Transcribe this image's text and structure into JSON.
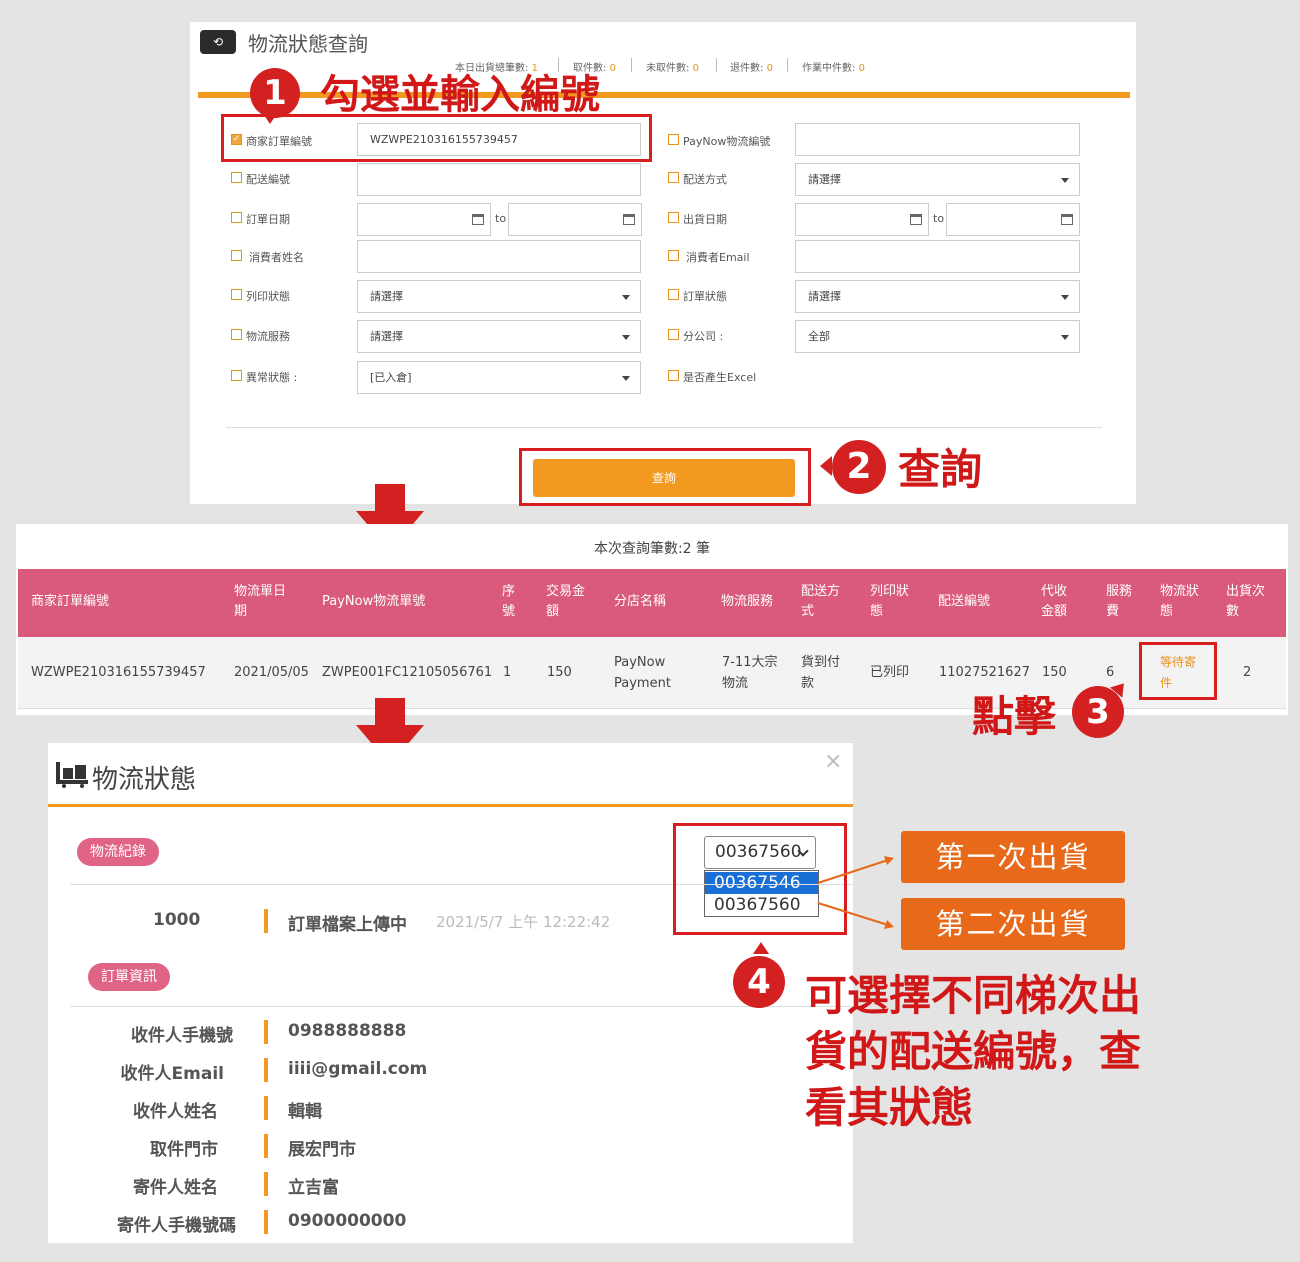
{
  "panel1": {
    "title": "物流狀態查詢",
    "stats": [
      {
        "label": "本日出貨總筆數:",
        "value": "1"
      },
      {
        "label": "取件數:",
        "value": "0"
      },
      {
        "label": "未取件數:",
        "value": "0"
      },
      {
        "label": "退件數:",
        "value": "0"
      },
      {
        "label": "作業中件數:",
        "value": "0"
      }
    ],
    "left_fields": [
      {
        "label": "商家訂單編號",
        "checked": true,
        "value": "WZWPE210316155739457"
      },
      {
        "label": "配送編號",
        "value": ""
      },
      {
        "label": "訂單日期",
        "to": "to"
      },
      {
        "label": "消費者姓名",
        "value": ""
      },
      {
        "label": "列印狀態",
        "value": "請選擇"
      },
      {
        "label": "物流服務",
        "value": "請選擇"
      },
      {
        "label": "異常狀態 :",
        "value": "[已入倉]"
      }
    ],
    "right_fields": [
      {
        "label": "PayNow物流編號",
        "value": ""
      },
      {
        "label": "配送方式",
        "value": "請選擇"
      },
      {
        "label": "出貨日期",
        "to": "to"
      },
      {
        "label": "消費者Email",
        "value": ""
      },
      {
        "label": "訂單狀態",
        "value": "請選擇"
      },
      {
        "label": "分公司 :",
        "value": "全部"
      },
      {
        "label": "是否產生Excel"
      }
    ],
    "query_button": "查詢"
  },
  "annotations": {
    "step1_number": "1",
    "step1_text": "勾選並輸入編號",
    "step2_number": "2",
    "step2_text": "查詢",
    "step3_number": "3",
    "step3_text": "點擊",
    "step4_number": "4",
    "step4_lines": [
      "可選擇不同梯次出",
      "貨的配送編號，查",
      "看其狀態"
    ],
    "tag_first": "第一次出貨",
    "tag_second": "第二次出貨"
  },
  "panel2": {
    "count_text": "本次查詢筆數:2 筆",
    "headers": [
      "商家訂單編號",
      "物流單日\n期",
      "PayNow物流單號",
      "序\n號",
      "交易金\n額",
      "分店名稱",
      "物流服務",
      "配送方\n式",
      "列印狀\n態",
      "配送編號",
      "代收\n金額",
      "服務\n費",
      "物流狀\n態",
      "出貨次\n數"
    ],
    "row": [
      "WZWPE210316155739457",
      "2021/05/05",
      "ZWPE001FC12105056761",
      "1",
      "150",
      "PayNow\nPayment",
      "7-11大宗\n物流",
      "貨到付\n款",
      "已列印",
      "11027521627",
      "150",
      "6",
      "等待寄\n件",
      "2"
    ]
  },
  "panel3": {
    "title": "物流狀態",
    "close": "×",
    "record_pill": "物流紀錄",
    "status_code": "1000",
    "status_text": "訂單檔案上傳中",
    "status_time": "2021/5/7 上午 12:22:42",
    "select_value": "00367560",
    "options": [
      "00367546",
      "00367560"
    ],
    "order_pill": "訂單資訊",
    "info": [
      {
        "k": "收件人手機號",
        "v": "0988888888"
      },
      {
        "k": "收件人Email",
        "v": "iiii@gmail.com"
      },
      {
        "k": "收件人姓名",
        "v": "輯輯"
      },
      {
        "k": "取件門市",
        "v": "展宏門市"
      },
      {
        "k": "寄件人姓名",
        "v": "立吉富"
      },
      {
        "k": "寄件人手機號碼",
        "v": "0900000000"
      }
    ]
  },
  "colors": {
    "orange": "#f29a1f",
    "pink": "#da5a7c",
    "red": "#d32020",
    "tag": "#e8691a",
    "highlight": "#1a6fd6"
  }
}
